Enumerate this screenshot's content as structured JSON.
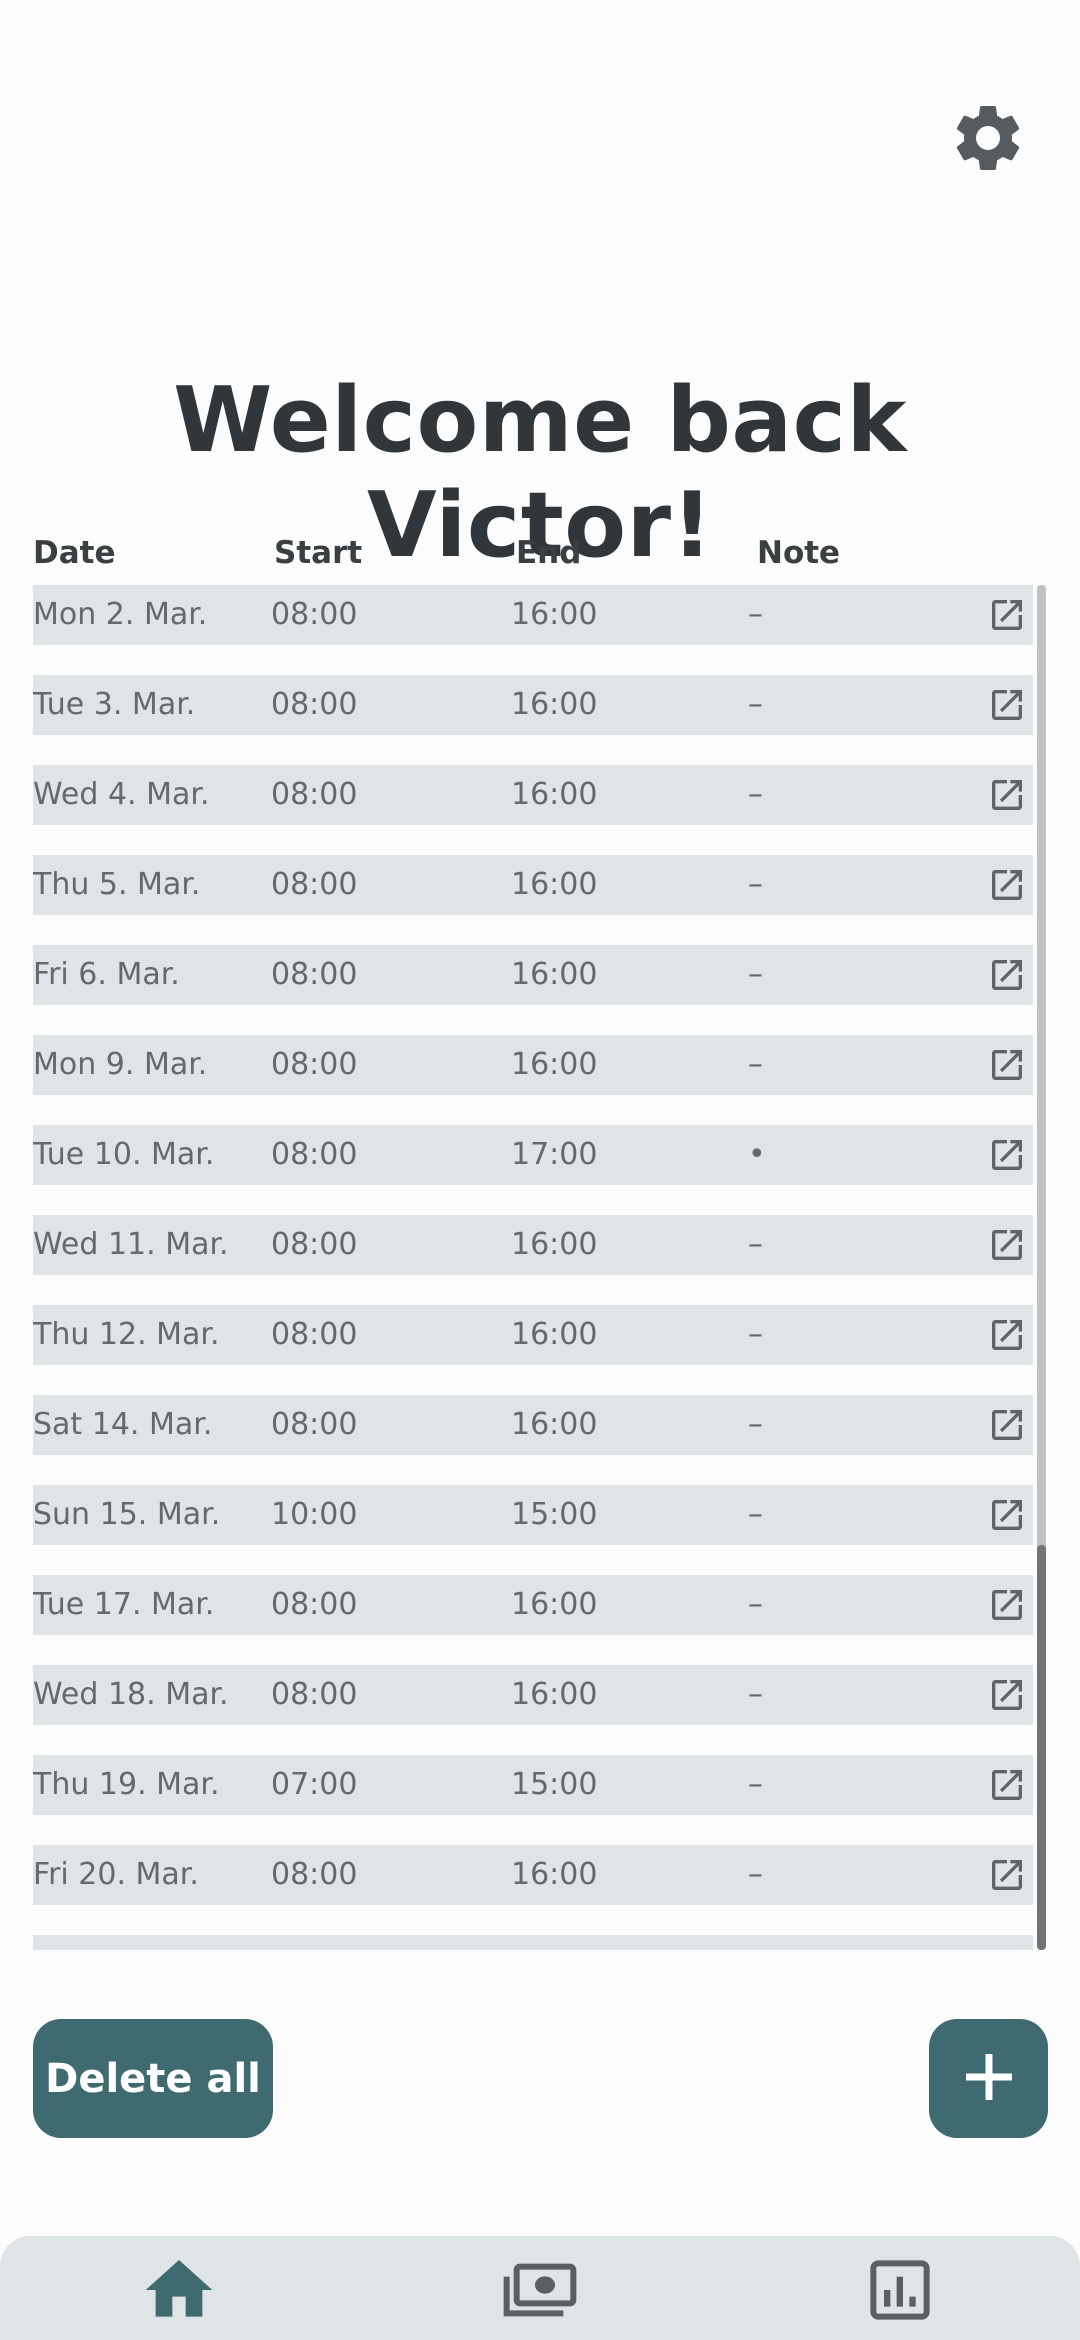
{
  "title": "Welcome back Victor!",
  "icons": {
    "settings": "gear-icon",
    "edit": "open-in-new-icon",
    "add": "plus-icon",
    "home": "home-icon",
    "payments": "banknotes-icon",
    "stats": "bar-chart-icon"
  },
  "colors": {
    "accent": "#3f6b70",
    "row_background": "#dfe5e6",
    "text": "#303639"
  },
  "table": {
    "headers": {
      "date": "Date",
      "start": "Start",
      "end": "End",
      "note": "Note"
    },
    "rows": [
      {
        "date": "Mon 2. Mar.",
        "start": "08:00",
        "end": "16:00",
        "note": "–"
      },
      {
        "date": "Tue 3. Mar.",
        "start": "08:00",
        "end": "16:00",
        "note": "–"
      },
      {
        "date": "Wed 4. Mar.",
        "start": "08:00",
        "end": "16:00",
        "note": "–"
      },
      {
        "date": "Thu 5. Mar.",
        "start": "08:00",
        "end": "16:00",
        "note": "–"
      },
      {
        "date": "Fri 6. Mar.",
        "start": "08:00",
        "end": "16:00",
        "note": "–"
      },
      {
        "date": "Mon 9. Mar.",
        "start": "08:00",
        "end": "16:00",
        "note": "–"
      },
      {
        "date": "Tue 10. Mar.",
        "start": "08:00",
        "end": "17:00",
        "note": "•"
      },
      {
        "date": "Wed 11. Mar.",
        "start": "08:00",
        "end": "16:00",
        "note": "–"
      },
      {
        "date": "Thu 12. Mar.",
        "start": "08:00",
        "end": "16:00",
        "note": "–"
      },
      {
        "date": "Sat 14. Mar.",
        "start": "08:00",
        "end": "16:00",
        "note": "–"
      },
      {
        "date": "Sun 15. Mar.",
        "start": "10:00",
        "end": "15:00",
        "note": "–"
      },
      {
        "date": "Tue 17. Mar.",
        "start": "08:00",
        "end": "16:00",
        "note": "–"
      },
      {
        "date": "Wed 18. Mar.",
        "start": "08:00",
        "end": "16:00",
        "note": "–"
      },
      {
        "date": "Thu 19. Mar.",
        "start": "07:00",
        "end": "15:00",
        "note": "–"
      },
      {
        "date": "Fri 20. Mar.",
        "start": "08:00",
        "end": "16:00",
        "note": "–"
      },
      {
        "date": "",
        "start": "",
        "end": "",
        "note": ""
      }
    ]
  },
  "actions": {
    "delete_all": "Delete all"
  }
}
